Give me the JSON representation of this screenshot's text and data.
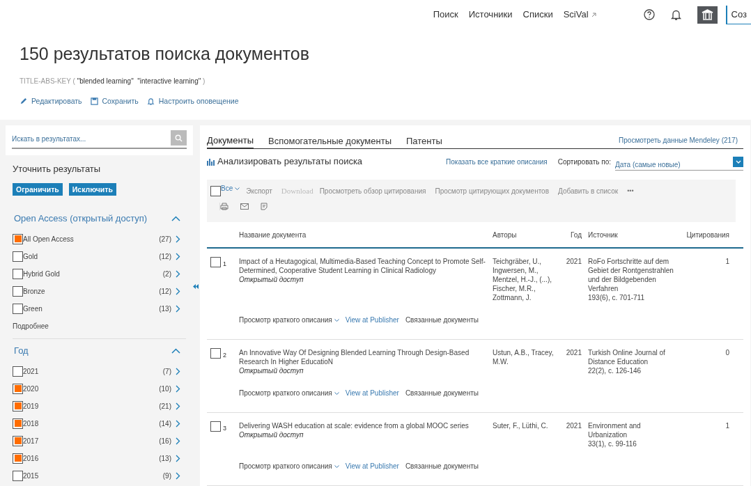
{
  "nav": {
    "links": [
      {
        "label": "Поиск",
        "external": false
      },
      {
        "label": "Источники",
        "external": false
      },
      {
        "label": "Списки",
        "external": false
      },
      {
        "label": "SciVal",
        "external": true
      }
    ],
    "create_button": "Соз"
  },
  "header": {
    "title": "150 результатов поиска документов",
    "query_field": "TITLE-ABS-KEY (",
    "query_terms": "\"blended learning\"  \"interactive learning\"",
    "query_end": ")",
    "actions": [
      {
        "kind": "edit",
        "label": "Редактировать"
      },
      {
        "kind": "save",
        "label": "Сохранить"
      },
      {
        "kind": "alert",
        "label": "Настроить оповещение"
      }
    ]
  },
  "sidebar": {
    "search_placeholder": "Искать в результатах...",
    "refine_title": "Уточнить результаты",
    "buttons": [
      "Ограничить",
      "Исключить"
    ],
    "sections": [
      {
        "title": "Open Access (открытый доступ)",
        "expanded": true,
        "more": "Подробнее",
        "items": [
          {
            "label": "All Open Access",
            "count": "(27)",
            "checked": true
          },
          {
            "label": "Gold",
            "count": "(12)",
            "checked": false
          },
          {
            "label": "Hybrid Gold",
            "count": "(2)",
            "checked": false
          },
          {
            "label": "Bronze",
            "count": "(12)",
            "checked": false
          },
          {
            "label": "Green",
            "count": "(13)",
            "checked": false
          }
        ]
      },
      {
        "title": "Год",
        "expanded": true,
        "items": [
          {
            "label": "2021",
            "count": "(7)",
            "checked": false
          },
          {
            "label": "2020",
            "count": "(10)",
            "checked": true
          },
          {
            "label": "2019",
            "count": "(21)",
            "checked": true
          },
          {
            "label": "2018",
            "count": "(14)",
            "checked": true
          },
          {
            "label": "2017",
            "count": "(16)",
            "checked": true
          },
          {
            "label": "2016",
            "count": "(13)",
            "checked": true
          },
          {
            "label": "2015",
            "count": "(9)",
            "checked": false
          }
        ]
      }
    ]
  },
  "tabs": [
    {
      "label": "Документы",
      "selected": true
    },
    {
      "label": "Вспомогательные документы",
      "selected": false
    },
    {
      "label": "Патенты",
      "selected": false
    }
  ],
  "mendeley_link": "Просмотреть данные Mendeley (217)",
  "analyze": "Анализировать результаты поиска",
  "show_abstracts": "Показать все краткие описания",
  "sort_label": "Сортировать по:",
  "sort_value": "Дата (самые новые)",
  "toolbar": {
    "select_all": "Все",
    "select_all_checked": false,
    "actions": [
      {
        "label": "Экспорт",
        "disabled": false
      },
      {
        "label": "Download",
        "disabled": true
      },
      {
        "label": "Просмотреть обзор цитирования",
        "disabled": false
      },
      {
        "label": "Просмотр цитирующих документов",
        "disabled": false
      },
      {
        "label": "Добавить в список",
        "disabled": false
      }
    ],
    "more": "•••"
  },
  "table": {
    "columns": [
      "Название документа",
      "Авторы",
      "Год",
      "Источник",
      "Цитирования"
    ],
    "rows": [
      {
        "number": "1",
        "checked": false,
        "title": "Impact of a Heutagogical, Multimedia-Based Teaching Concept to Promote Self-Determined, Cooperative Student Learning in Clinical Radiology",
        "access": "Открытый доступ",
        "authors": "Teichgräber, U., Ingwersen, M., Mentzel, H.-J., (...), Fischer, M.R., Zottmann, J.",
        "year": "2021",
        "source": "RoFo Fortschritte auf dem Gebiet der Rontgenstrahlen und der Bildgebenden Verfahren",
        "source_details": "193(6), с. 701-711",
        "citations": "1",
        "links": [
          "Просмотр краткого описания",
          "View at Publisher",
          "Связанные документы"
        ]
      },
      {
        "number": "2",
        "checked": false,
        "title": "An Innovative Way Of Designing Blended Learning Through Design-Based Research In Higher EducatioN",
        "access": "Открытый доступ",
        "authors": "Ustun, A.B., Tracey, M.W.",
        "year": "2021",
        "source": "Turkish Online Journal of Distance Education",
        "source_details": "22(2), с. 126-146",
        "citations": "0",
        "links": [
          "Просмотр краткого описания",
          "View at Publisher",
          "Связанные документы"
        ]
      },
      {
        "number": "3",
        "checked": false,
        "title": "Delivering WASH education at scale: evidence from a global MOOC series",
        "access": "Открытый доступ",
        "authors": "Suter, F., Lüthi, C.",
        "year": "2021",
        "source": "Environment and Urbanization",
        "source_details": "33(1), с. 99-116",
        "citations": "1",
        "links": [
          "Просмотр краткого описания",
          "View at Publisher",
          "Связанные документы"
        ]
      }
    ]
  }
}
